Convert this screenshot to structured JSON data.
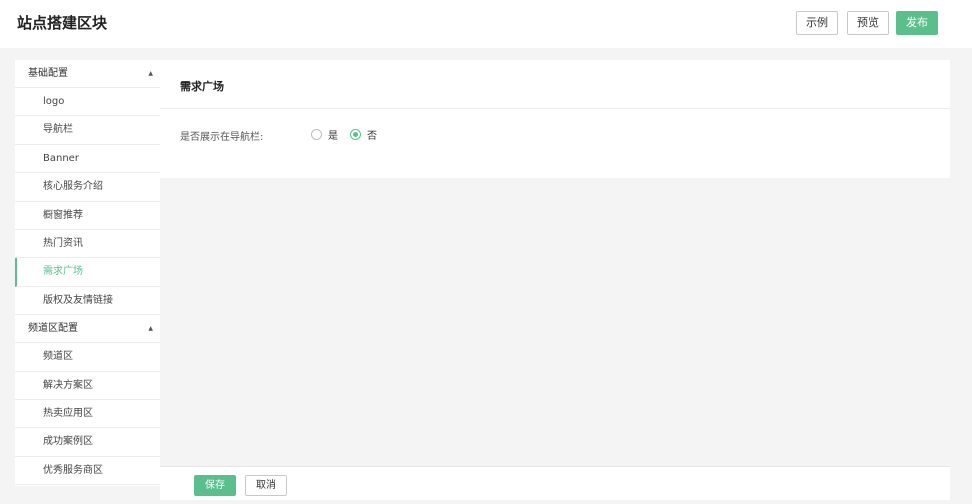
{
  "header": {
    "title": "站点搭建区块",
    "buttons": {
      "example": "示例",
      "preview": "预览",
      "publish": "发布"
    }
  },
  "sidebar": {
    "groups": [
      {
        "label": "基础配置",
        "items": [
          "logo",
          "导航栏",
          "Banner",
          "核心服务介绍",
          "橱窗推荐",
          "热门资讯",
          "需求广场",
          "版权及友情链接"
        ]
      },
      {
        "label": "频道区配置",
        "items": [
          "频道区",
          "解决方案区",
          "热卖应用区",
          "成功案例区",
          "优秀服务商区"
        ]
      }
    ],
    "active_item": "需求广场"
  },
  "content": {
    "title": "需求广场",
    "field_label": "是否展示在导航栏:",
    "options": [
      "是",
      "否"
    ],
    "selected": "否"
  },
  "footer": {
    "save": "保存",
    "cancel": "取消"
  },
  "colors": {
    "accent": "#5bbf8d",
    "background": "#f4f4f4",
    "divider": "#ececec"
  },
  "icons": {
    "group_caret": "caret-up-icon"
  }
}
